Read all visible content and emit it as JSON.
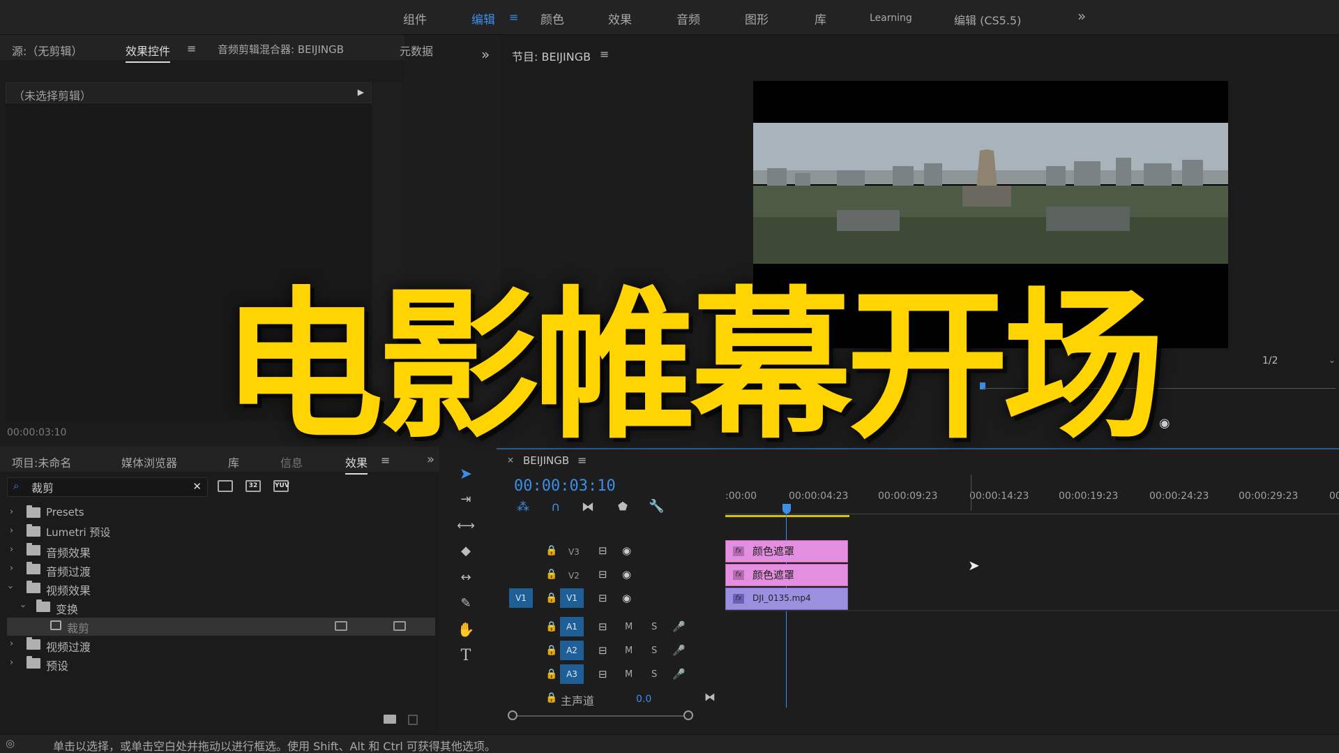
{
  "workspaces": {
    "items": [
      "组件",
      "编辑",
      "颜色",
      "效果",
      "音频",
      "图形",
      "库",
      "Learning",
      "编辑 (CS5.5)"
    ],
    "active_index": 1,
    "overflow": "»"
  },
  "source_panel": {
    "tabs": [
      "源:（无剪辑）",
      "效果控件",
      "音频剪辑混合器: BEIJINGB",
      "元数据"
    ],
    "active_tab": "效果控件",
    "no_clip_text": "（未选择剪辑）",
    "timecode": "00:00:03:10"
  },
  "program_monitor": {
    "title": "节目: BEIJINGB",
    "resolution": "1/2"
  },
  "project_panel": {
    "tabs": [
      "项目:未命名",
      "媒体浏览器",
      "库",
      "信息",
      "效果"
    ],
    "active_tab": "效果",
    "search_value": "裁剪",
    "tree": [
      {
        "label": "Presets",
        "expanded": false,
        "indent": 0
      },
      {
        "label": "Lumetri 预设",
        "expanded": false,
        "indent": 0
      },
      {
        "label": "音频效果",
        "expanded": false,
        "indent": 0
      },
      {
        "label": "音频过渡",
        "expanded": false,
        "indent": 0
      },
      {
        "label": "视频效果",
        "expanded": true,
        "indent": 0
      },
      {
        "label": "变换",
        "expanded": true,
        "indent": 1
      },
      {
        "label": "裁剪",
        "expanded": false,
        "indent": 2,
        "selected": true
      },
      {
        "label": "视频过渡",
        "expanded": false,
        "indent": 0
      },
      {
        "label": "预设",
        "expanded": false,
        "indent": 0
      }
    ],
    "badge_labels": [
      "32",
      "YUV"
    ]
  },
  "timeline": {
    "sequence_name": "BEIJINGB",
    "timecode": "00:00:03:10",
    "ruler": [
      ":00:00",
      "00:00:04:23",
      "00:00:09:23",
      "00:00:14:23",
      "00:00:19:23",
      "00:00:24:23",
      "00:00:29:23",
      "00"
    ],
    "video_tracks": [
      {
        "name": "V3",
        "clip": "颜色遮罩"
      },
      {
        "name": "V2",
        "clip": "颜色遮罩"
      },
      {
        "name": "V1",
        "clip": "DJI_0135.mp4",
        "source_patch": "V1"
      }
    ],
    "audio_tracks": [
      "A1",
      "A2",
      "A3"
    ],
    "mute_label": "M",
    "solo_label": "S",
    "master_label": "主声道",
    "master_value": "0.0"
  },
  "status_bar": {
    "text": "单击以选择，或单击空白处并拖动以进行框选。使用 Shift、Alt 和 Ctrl 可获得其他选项。"
  },
  "overlay_title": "电影帷幕开场",
  "colors": {
    "accent_blue": "#3d8ee8",
    "title_yellow": "#ffd400",
    "clip_pink": "#e48ee0",
    "clip_violet": "#9b8fe0"
  }
}
